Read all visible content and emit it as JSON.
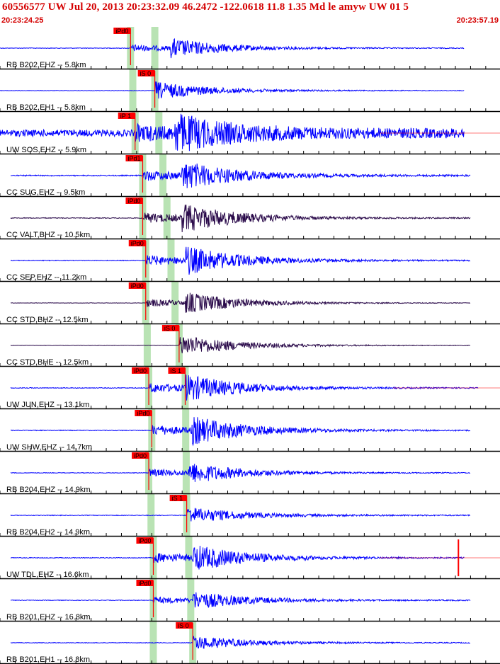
{
  "header": {
    "title": "60556577 UW Jul 20, 2013 20:23:32.09   46.2472 -122.0618 11.8 1.35 Md le amyw UW 01   5",
    "start_time": "20:23:24.25",
    "end_time": "20:23:57.19"
  },
  "colors": {
    "trace": "#0000ff",
    "trace_dark": "#2a0a4a",
    "pick": "#ff0000",
    "pick_band": "#b9e3b4",
    "header": "#d40000"
  },
  "chart_data": {
    "type": "line",
    "x_range": [
      "20:23:24.25",
      "20:23:57.19"
    ],
    "traces": [
      {
        "label": "RB B202,EHZ -- 5.8km",
        "pick": "iPd0",
        "pick_type": "P",
        "pick_time_s": 8.6,
        "amp": 0.55,
        "noise": 0.015,
        "color": "trace",
        "end_s": 30.6
      },
      {
        "label": "RB B202,EH1 -- 5.8km",
        "pick": "iS 0",
        "pick_type": "S",
        "pick_time_s": 10.2,
        "amp": 0.5,
        "noise": 0.012,
        "color": "trace",
        "end_s": 30.6
      },
      {
        "label": "UW SOS,EHZ -- 5.9km",
        "pick": "iP 1",
        "pick_type": "P",
        "pick_time_s": 8.9,
        "amp": 0.95,
        "noise": 0.18,
        "color": "trace",
        "end_s": 30.6,
        "tail_red": true
      },
      {
        "label": "CC SUG,EHZ -- 9.5km",
        "pick": "iPd1",
        "pick_type": "P",
        "pick_time_s": 9.4,
        "amp": 0.8,
        "noise": 0.03,
        "color": "trace",
        "end_s": 31.0
      },
      {
        "label": "CC VALT,BHZ -- 10.5km",
        "pick": "iPd0",
        "pick_type": "P",
        "pick_time_s": 9.4,
        "amp": 0.8,
        "noise": 0.02,
        "color": "trace_dark",
        "end_s": 31.0
      },
      {
        "label": "CC SEP,EHZ -- 11.2km",
        "pick": "iPd0",
        "pick_type": "P",
        "pick_time_s": 9.6,
        "amp": 0.8,
        "noise": 0.02,
        "color": "trace",
        "end_s": 31.0
      },
      {
        "label": "CC STD,BHZ -- 12.5km",
        "pick": "iPd0",
        "pick_type": "P",
        "pick_time_s": 9.6,
        "amp": 0.6,
        "noise": 0.01,
        "color": "trace_dark",
        "end_s": 31.0
      },
      {
        "label": "CC STD,BHE -- 12.5km",
        "pick": "iS 0",
        "pick_type": "S",
        "pick_time_s": 11.8,
        "amp": 0.6,
        "noise": 0.01,
        "color": "trace_dark",
        "end_s": 31.0
      },
      {
        "label": "UW JUN,EHZ -- 13.1km",
        "pick": "iPd0",
        "pick_type": "P",
        "pick_time_s": 9.8,
        "pick2": "iS 1",
        "pick2_time_s": 12.2,
        "amp": 0.75,
        "noise": 0.02,
        "color": "trace",
        "end_s": 31.5,
        "tail_red": true
      },
      {
        "label": "UW SHW,EHZ -- 14.7km",
        "pick": "iPd0",
        "pick_type": "P",
        "pick_time_s": 10.0,
        "amp": 0.8,
        "noise": 0.02,
        "color": "trace",
        "end_s": 31.0
      },
      {
        "label": "RB B204,EHZ -- 14.9km",
        "pick": "iPd0",
        "pick_type": "P",
        "pick_time_s": 9.8,
        "amp": 0.6,
        "noise": 0.015,
        "color": "trace",
        "end_s": 31.0
      },
      {
        "label": "RB B204,EH2 -- 14.9km",
        "pick": "iS 1",
        "pick_type": "S",
        "pick_time_s": 12.3,
        "amp": 0.45,
        "noise": 0.02,
        "color": "trace",
        "end_s": 31.0
      },
      {
        "label": "UW TDL,EHZ -- 16.6km",
        "pick": "iPd0",
        "pick_type": "P",
        "pick_time_s": 10.1,
        "amp": 0.75,
        "noise": 0.02,
        "color": "trace",
        "end_s": 30.6,
        "tail_red": true,
        "spike_s": 30.2
      },
      {
        "label": "RB B201,EHZ -- 16.8km",
        "pick": "iPd0",
        "pick_type": "P",
        "pick_time_s": 10.1,
        "amp": 0.5,
        "noise": 0.02,
        "color": "trace",
        "end_s": 31.0
      },
      {
        "label": "RB B201,EH1 -- 16.8km",
        "pick": "iS 0",
        "pick_type": "S",
        "pick_time_s": 12.7,
        "amp": 0.4,
        "noise": 0.015,
        "color": "trace",
        "end_s": 31.0
      }
    ]
  }
}
